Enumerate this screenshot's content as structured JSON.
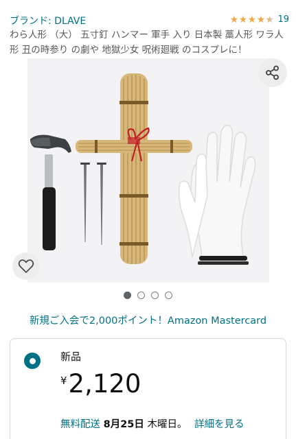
{
  "brand": {
    "label": "ブランド: DLAVE"
  },
  "rating": {
    "stars": 4.5,
    "max": 5,
    "count": "19",
    "color": "#F3A847"
  },
  "title": "わら人形 （大） 五寸釘 ハンマー 軍手 入り 日本製 藁人形 ワラ人形 丑の時参り の劇や 地獄少女 呪術廻戦 のコスプレに！",
  "gallery": {
    "share_icon": "share-icon",
    "favorite_icon": "heart-icon",
    "image_count": 4,
    "active_index": 0
  },
  "promo": {
    "text": "新規ご入会で2,000ポイント！Amazon Mastercard"
  },
  "offer": {
    "condition": "新品",
    "currency_symbol": "¥",
    "price": "2,120",
    "delivery_free": "無料配送",
    "delivery_date": "8月25日",
    "delivery_weekday": "木曜日。",
    "details_link": "詳細を見る"
  },
  "colors": {
    "link": "#007185",
    "text": "#0F1111",
    "muted": "#565959",
    "star": "#F3A847"
  }
}
